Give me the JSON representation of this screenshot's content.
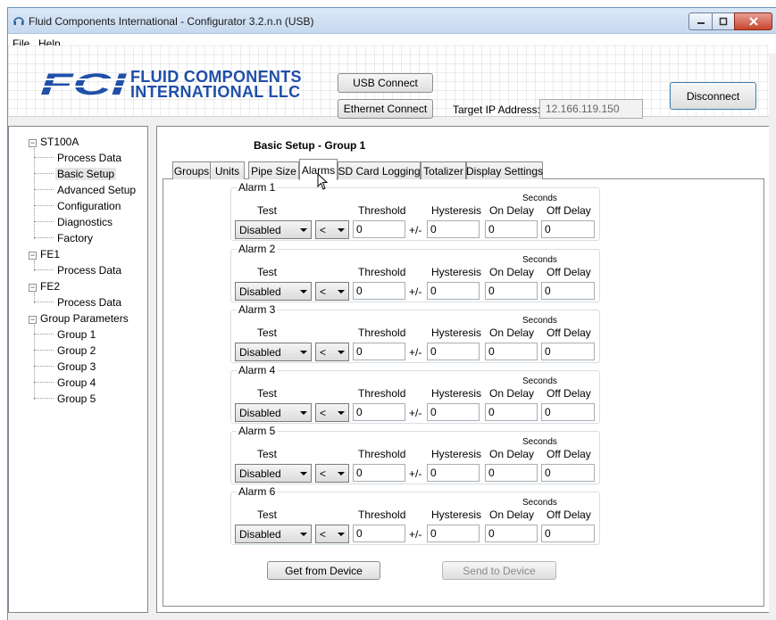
{
  "window": {
    "title": "Fluid Components International - Configurator 3.2.n.n (USB)"
  },
  "menu": [
    "File",
    "Help"
  ],
  "banner": {
    "logo_letters": "FCI",
    "company_line1": "FLUID COMPONENTS",
    "company_line2": "INTERNATIONAL LLC",
    "usb_connect": "USB Connect",
    "ethernet_connect": "Ethernet Connect",
    "ip_label": "Target IP Address:",
    "ip_value": "12.166.119.150",
    "disconnect": "Disconnect"
  },
  "tree": {
    "nodes": [
      {
        "label": "ST100A"
      },
      {
        "label": "Process Data"
      },
      {
        "label": "Basic Setup"
      },
      {
        "label": "Advanced Setup"
      },
      {
        "label": "Configuration"
      },
      {
        "label": "Diagnostics"
      },
      {
        "label": "Factory"
      },
      {
        "label": "FE1"
      },
      {
        "label": "Process Data"
      },
      {
        "label": "FE2"
      },
      {
        "label": "Process Data"
      },
      {
        "label": "Group Parameters"
      },
      {
        "label": "Group 1"
      },
      {
        "label": "Group 2"
      },
      {
        "label": "Group 3"
      },
      {
        "label": "Group 4"
      },
      {
        "label": "Group 5"
      }
    ],
    "selected": "Basic Setup"
  },
  "main": {
    "title": "Basic Setup - Group 1",
    "tabs": [
      "Groups",
      "Units",
      "Pipe Size",
      "Alarms",
      "SD Card Logging",
      "Totalizer",
      "Display Settings"
    ],
    "active_tab": "Alarms",
    "col_labels": {
      "test": "Test",
      "threshold": "Threshold",
      "hysteresis": "Hysteresis",
      "seconds": "Seconds",
      "on_delay": "On Delay",
      "off_delay": "Off Delay",
      "plusminus": "+/-"
    },
    "alarms": [
      {
        "name": "Alarm 1",
        "test": "Disabled",
        "op": "<",
        "threshold": "0",
        "hysteresis": "0",
        "on_delay": "0",
        "off_delay": "0"
      },
      {
        "name": "Alarm 2",
        "test": "Disabled",
        "op": "<",
        "threshold": "0",
        "hysteresis": "0",
        "on_delay": "0",
        "off_delay": "0"
      },
      {
        "name": "Alarm 3",
        "test": "Disabled",
        "op": "<",
        "threshold": "0",
        "hysteresis": "0",
        "on_delay": "0",
        "off_delay": "0"
      },
      {
        "name": "Alarm 4",
        "test": "Disabled",
        "op": "<",
        "threshold": "0",
        "hysteresis": "0",
        "on_delay": "0",
        "off_delay": "0"
      },
      {
        "name": "Alarm 5",
        "test": "Disabled",
        "op": "<",
        "threshold": "0",
        "hysteresis": "0",
        "on_delay": "0",
        "off_delay": "0"
      },
      {
        "name": "Alarm 6",
        "test": "Disabled",
        "op": "<",
        "threshold": "0",
        "hysteresis": "0",
        "on_delay": "0",
        "off_delay": "0"
      }
    ],
    "get_button": "Get from Device",
    "send_button": "Send to Device"
  },
  "colors": {
    "logo_blue": "#1f4fa8",
    "titlebar": "#c6d9ef"
  }
}
